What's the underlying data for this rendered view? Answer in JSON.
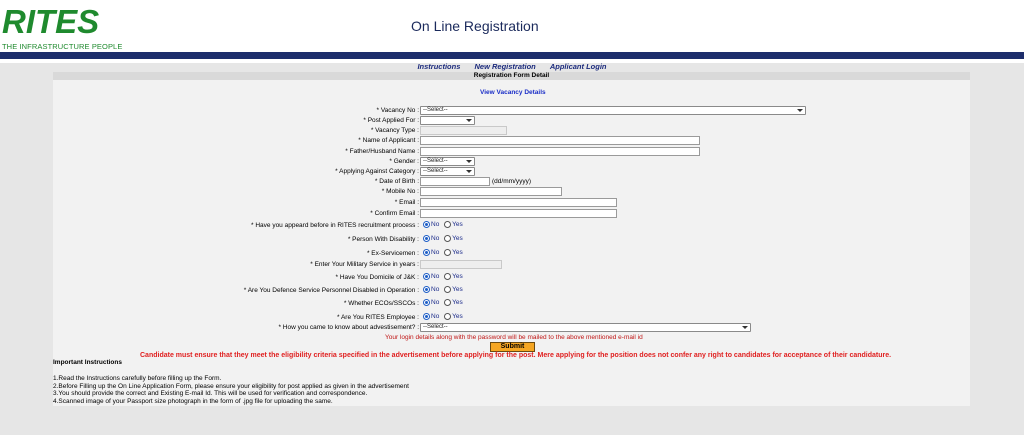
{
  "brand": {
    "logo_text": "RITES",
    "tagline": "THE INFRASTRUCTURE PEOPLE",
    "title": "On Line Registration",
    "colors": {
      "green": "#1f8a2e",
      "navy": "#1d2d6b",
      "link": "#1a2ec7",
      "alert": "#e02020"
    }
  },
  "nav": {
    "items": [
      "Instructions",
      "New Registration",
      "Applicant Login"
    ]
  },
  "form": {
    "heading": "Registration Form Detail",
    "view_link": "View Vacancy Details",
    "fields": {
      "vacancy_no": {
        "label": "* Vacancy No :",
        "value": "--Select--"
      },
      "post_applied": {
        "label": "* Post Applied For :",
        "value": ""
      },
      "vacancy_type": {
        "label": "* Vacancy Type :",
        "value": ""
      },
      "applicant_name": {
        "label": "* Name of Applicant :",
        "value": ""
      },
      "father_name": {
        "label": "* Father/Husband Name :",
        "value": ""
      },
      "gender": {
        "label": "* Gender :",
        "value": "--Select--"
      },
      "category": {
        "label": "* Applying Against Category :",
        "value": "--Select--"
      },
      "dob": {
        "label": "* Date of Birth :",
        "value": "",
        "hint": "(dd/mm/yyyy)"
      },
      "mobile": {
        "label": "* Mobile No :",
        "value": ""
      },
      "email": {
        "label": "* Email :",
        "value": ""
      },
      "confirm_email": {
        "label": "* Confirm Email :",
        "value": ""
      },
      "appeared_before": {
        "label": "* Have you appeard before in RITES recruitment process :",
        "selected": "No"
      },
      "disability": {
        "label": "* Person With Disability :",
        "selected": "No"
      },
      "ex_servicemen": {
        "label": "* Ex-Servicemen :",
        "selected": "No"
      },
      "military_years": {
        "label": "* Enter Your Military Service in years :",
        "value": ""
      },
      "domicile_jk": {
        "label": "* Have You Domicile of J&K :",
        "selected": "No"
      },
      "defence_disabled": {
        "label": "* Are You Defence Service Personnel Disabled in Operation :",
        "selected": "No"
      },
      "ecos_sscos": {
        "label": "* Whether ECOs/SSCOs :",
        "selected": "No"
      },
      "rites_employee": {
        "label": "* Are You RITES Employee :",
        "selected": "No"
      },
      "source": {
        "label": "* How you came to know about advestisement? :",
        "value": "--Select--"
      }
    },
    "radio_options": {
      "no": "No",
      "yes": "Yes"
    },
    "login_note": "Your login details along with the password will be mailed to the above mentioned e-mail id",
    "submit_label": "Submit",
    "warning": "Candidate must ensure that they meet the eligibility criteria specified in the advertisement before applying for the post. Mere applying for the position does not confer any right to candidates for acceptance of their candidature."
  },
  "instructions": {
    "title": "Important Instructions",
    "items": [
      "1.Read the Instructions carefully before filling up the Form.",
      "2.Before Filling up the On Line Application Form, please ensure your eligibility for post applied as given in the advertisement",
      "3.You should provide the correct and Existing E-mail Id. This will be used for verification and correspondence.",
      "4.Scanned image of your Passport size photograph in the form of .jpg file for uploading the same."
    ]
  }
}
